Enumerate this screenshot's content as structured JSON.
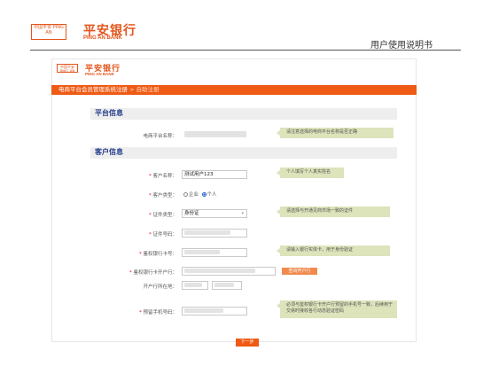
{
  "header": {
    "badge_text": "中国平安 PING AN",
    "bank_name": "平安银行",
    "bank_name_en": "PING AN BANK",
    "doc_title": "用户使用说明书"
  },
  "inner_logo": {
    "bank_name": "平安银行",
    "bank_name_en": "PING AN BANK"
  },
  "breadcrumb": {
    "main": "电商平台会员管理系统注册",
    "sub": " > 自助注册"
  },
  "platform_section": {
    "title": "平台信息",
    "name_label": "电商平台名称：",
    "name_tip": "请注意选择的电商平台名称是否正确"
  },
  "customer_section": {
    "title": "客户信息",
    "customer_name_label": "客户名称：",
    "customer_name_value": "测试用户123",
    "customer_name_tip": "个人填写个人真实姓名",
    "customer_type_label": "客户类型：",
    "type_options": [
      "企业",
      "个人"
    ],
    "type_selected": "个人",
    "id_type_label": "证件类型：",
    "id_type_value": "身份证",
    "id_type_tip": "请选择与开通见商市场一致的证件",
    "id_number_label": "证件号码：",
    "card_label": "鉴权银行卡号：",
    "card_tip": "请输入银行实体卡，用于身份验证",
    "card_branch_label": "鉴权银行卡开户行：",
    "branch_button": "查询开户行",
    "location_label": "开户行所在地：",
    "phone_label": "预留手机号码：",
    "phone_tip": "必须与鉴权银行卡开户行预留的手机号一致，后续用于交易时接收各行动态验证密码",
    "next_button": "下一步"
  }
}
